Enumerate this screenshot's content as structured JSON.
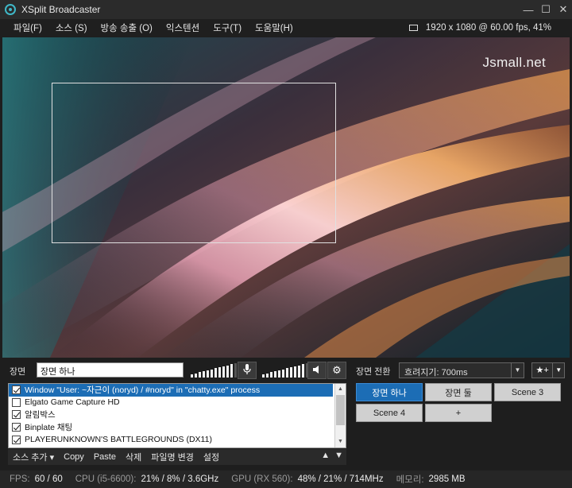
{
  "window": {
    "title": "XSplit Broadcaster",
    "minimize": "—",
    "maximize": "☐",
    "close": "✕"
  },
  "menu": [
    "파일(F)",
    "소스 (S)",
    "방송 송출 (O)",
    "익스텐션",
    "도구(T)",
    "도움말(H)"
  ],
  "resolution": "1920 x 1080 @ 60.00 fps, 41%",
  "preview": {
    "watermark": "Jsmall.net"
  },
  "scene": {
    "label": "장면",
    "name": "장면 하나",
    "mic_level": 0.9,
    "speaker_level": 0.9
  },
  "transition": {
    "label": "장면 전환",
    "value": "흐려지기: 700ms"
  },
  "sources": [
    {
      "label": "Window \"User: ~자근이 (noryd) / #noryd\" in \"chatty.exe\" process",
      "checked": true,
      "selected": true
    },
    {
      "label": "Elgato Game Capture HD",
      "checked": false,
      "selected": false
    },
    {
      "label": "알림박스",
      "checked": true,
      "selected": false
    },
    {
      "label": "Binplate 채팅",
      "checked": true,
      "selected": false
    },
    {
      "label": "PLAYERUNKNOWN'S BATTLEGROUNDS (DX11)",
      "checked": true,
      "selected": false
    }
  ],
  "source_toolbar": {
    "add": "소스 추가",
    "copy": "Copy",
    "paste": "Paste",
    "delete": "삭제",
    "rename": "파일명 변경",
    "settings": "설정",
    "up": "▲",
    "down": "▼"
  },
  "scenes": [
    {
      "label": "장면 하나",
      "active": true
    },
    {
      "label": "장면 둘",
      "active": false
    },
    {
      "label": "Scene 3",
      "active": false
    },
    {
      "label": "Scene 4",
      "active": false
    },
    {
      "label": "+",
      "active": false
    }
  ],
  "status": {
    "fps_key": "FPS:",
    "fps_val": "60 / 60",
    "cpu_key": "CPU (i5-6600):",
    "cpu_val": "21% / 8% / 3.6GHz",
    "gpu_key": "GPU (RX 560):",
    "gpu_val": "48% / 21% / 714MHz",
    "mem_key": "메모리:",
    "mem_val": "2985 MB"
  },
  "colors": {
    "accent": "#1c6db5",
    "background": "#1e1e1e"
  }
}
